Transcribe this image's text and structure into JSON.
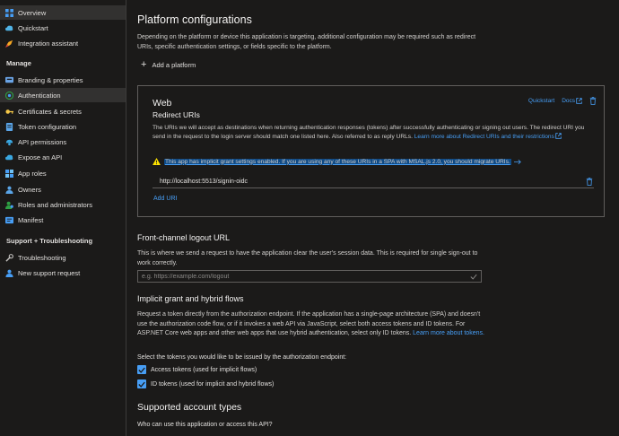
{
  "sidebar": {
    "items": [
      {
        "label": "Overview",
        "icon": "grid-icon",
        "active": true
      },
      {
        "label": "Quickstart",
        "icon": "cloud-icon"
      },
      {
        "label": "Integration assistant",
        "icon": "rocket-icon"
      }
    ],
    "manage_heading": "Manage",
    "manage_items": [
      {
        "label": "Branding & properties",
        "icon": "branding-icon"
      },
      {
        "label": "Authentication",
        "icon": "authentication-icon",
        "active": true
      },
      {
        "label": "Certificates & secrets",
        "icon": "key-icon"
      },
      {
        "label": "Token configuration",
        "icon": "token-icon"
      },
      {
        "label": "API permissions",
        "icon": "api-permissions-icon"
      },
      {
        "label": "Expose an API",
        "icon": "cloud-api-icon"
      },
      {
        "label": "App roles",
        "icon": "app-roles-icon"
      },
      {
        "label": "Owners",
        "icon": "owners-icon"
      },
      {
        "label": "Roles and administrators",
        "icon": "roles-icon"
      },
      {
        "label": "Manifest",
        "icon": "manifest-icon"
      }
    ],
    "support_heading": "Support + Troubleshooting",
    "support_items": [
      {
        "label": "Troubleshooting",
        "icon": "wrench-icon"
      },
      {
        "label": "New support request",
        "icon": "support-icon"
      }
    ]
  },
  "platform": {
    "title": "Platform configurations",
    "description": "Depending on the platform or device this application is targeting, additional configuration may be required such as redirect URIs, specific authentication settings, or fields specific to the platform.",
    "add_label": "Add a platform"
  },
  "web_card": {
    "title": "Web",
    "subtitle": "Redirect URIs",
    "quickstart": "Quickstart",
    "docs": "Docs",
    "description": "The URIs we will accept as destinations when returning authentication responses (tokens) after successfully authenticating or signing out users. The redirect URI you send in the request to the login server should match one listed here. Also referred to as reply URLs.",
    "learn_more": "Learn more about Redirect URIs and their restrictions",
    "warning": "This app has implicit grant settings enabled. If you are using any of these URIs in a SPA with MSAL.js 2.0, you should migrate URIs.",
    "uri": "http://localhost:5513/signin-oidc",
    "add_uri": "Add URI"
  },
  "logout": {
    "title": "Front-channel logout URL",
    "description": "This is where we send a request to have the application clear the user's session data. This is required for single sign-out to work correctly.",
    "placeholder": "e.g. https://example.com/logout"
  },
  "implicit": {
    "title": "Implicit grant and hybrid flows",
    "description": "Request a token directly from the authorization endpoint. If the application has a single-page architecture (SPA) and doesn't use the authorization code flow, or if it invokes a web API via JavaScript, select both access tokens and ID tokens. For ASP.NET Core web apps and other web apps that use hybrid authentication, select only ID tokens.",
    "learn_more": "Learn more about tokens.",
    "select_label": "Select the tokens you would like to be issued by the authorization endpoint:",
    "access_tokens": "Access tokens (used for implicit flows)",
    "id_tokens": "ID tokens (used for implicit and hybrid flows)",
    "access_checked": true,
    "id_checked": true
  },
  "account_types": {
    "title": "Supported account types",
    "question": "Who can use this application or access this API?"
  },
  "colors": {
    "accent": "#479ef5",
    "warning": "#fce100",
    "highlight": "#0f4a85"
  }
}
